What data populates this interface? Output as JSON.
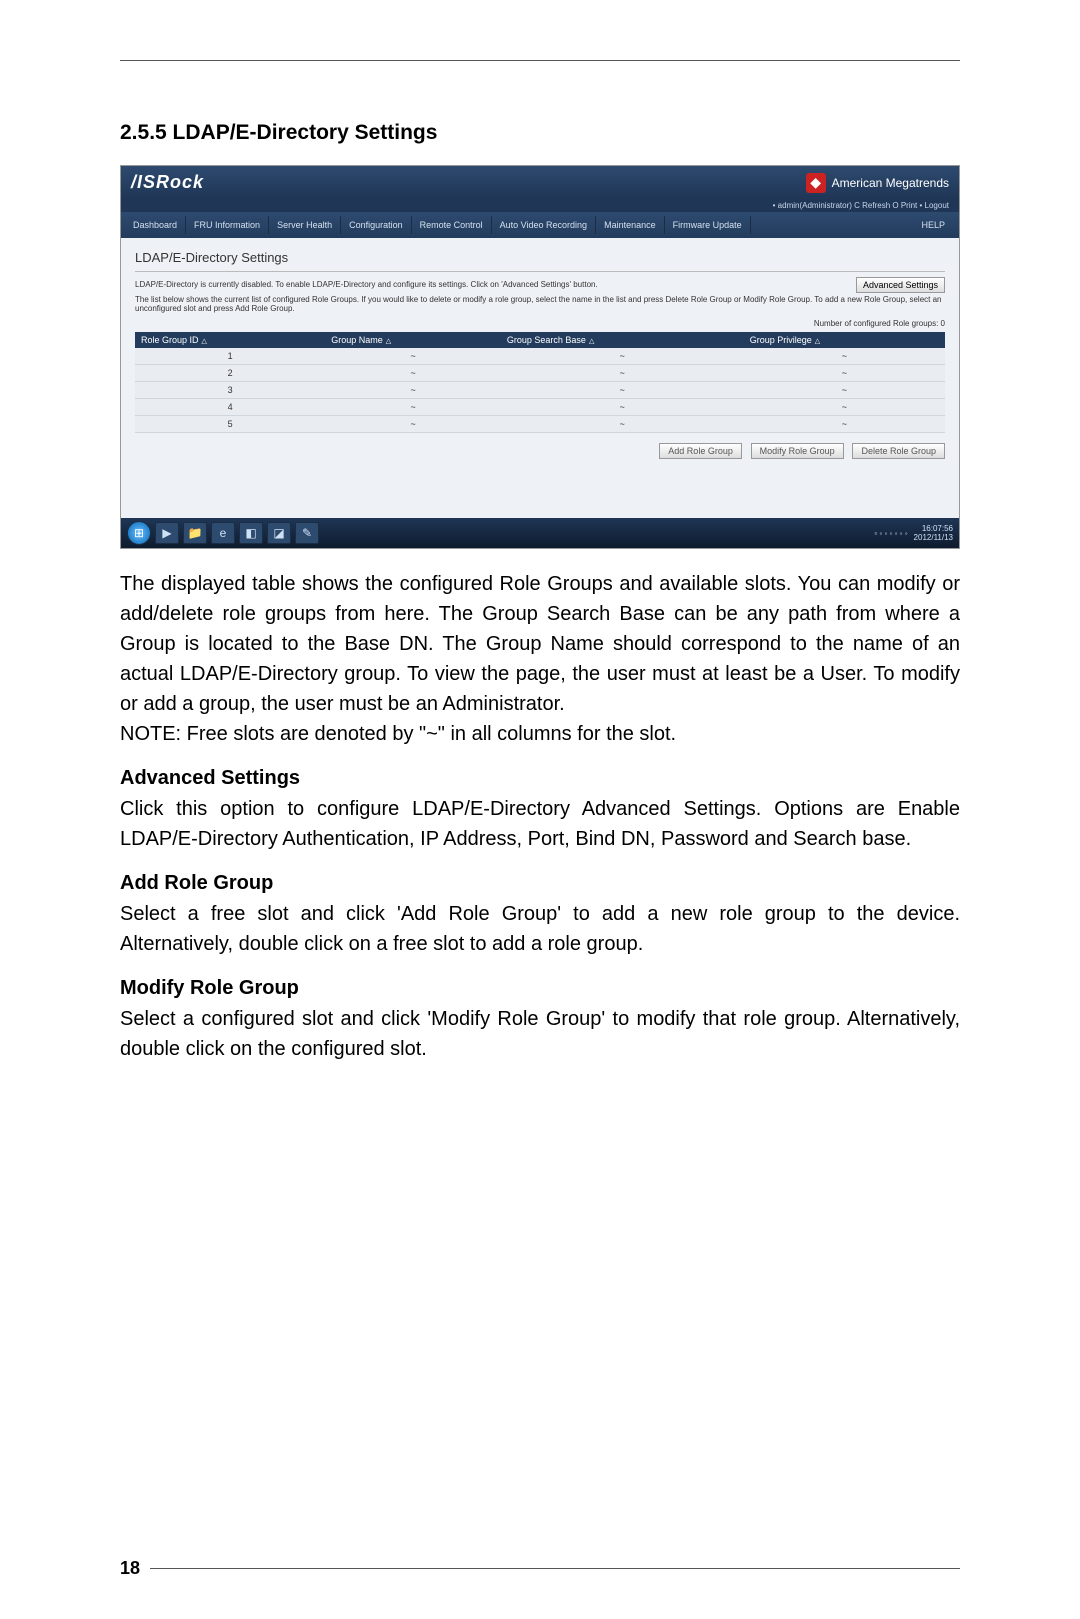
{
  "section_title": "2.5.5  LDAP/E-Directory Settings",
  "screenshot": {
    "logo": "/ISRock",
    "brand": "American Megatrends",
    "topbar": "• admin(Administrator)   C Refresh   O Print   • Logout",
    "nav": [
      "Dashboard",
      "FRU Information",
      "Server Health",
      "Configuration",
      "Remote Control",
      "Auto Video Recording",
      "Maintenance",
      "Firmware Update"
    ],
    "help": "HELP",
    "page_title": "LDAP/E-Directory Settings",
    "desc1": "LDAP/E-Directory is currently disabled. To enable LDAP/E-Directory and configure its settings. Click on 'Advanced Settings' button.",
    "adv_btn": "Advanced Settings",
    "desc2": "The list below shows the current list of configured Role Groups. If you would like to delete or modify a role group, select the name in the list and press Delete Role Group or Modify Role Group. To add a new Role Group, select an unconfigured slot and press Add Role Group.",
    "count_label": "Number of configured Role groups: 0",
    "columns": [
      "Role Group ID",
      "Group Name",
      "Group Search Base",
      "Group Privilege"
    ],
    "rows": [
      {
        "id": "1",
        "name": "~",
        "base": "~",
        "priv": "~"
      },
      {
        "id": "2",
        "name": "~",
        "base": "~",
        "priv": "~"
      },
      {
        "id": "3",
        "name": "~",
        "base": "~",
        "priv": "~"
      },
      {
        "id": "4",
        "name": "~",
        "base": "~",
        "priv": "~"
      },
      {
        "id": "5",
        "name": "~",
        "base": "~",
        "priv": "~"
      }
    ],
    "btn_add": "Add Role Group",
    "btn_mod": "Modify Role Group",
    "btn_del": "Delete Role Group",
    "time": "16:07:56\n2012/11/13"
  },
  "para1": "The displayed table shows the configured Role Groups and available slots. You can modify or add/delete role groups from here. The Group Search Base can be any path from where a Group is located to the Base DN. The Group Name should correspond to the name of an actual LDAP/E-Directory group. To view the page, the user must at least be a User. To modify or add a group, the user must be an Administrator.",
  "para1_note": "NOTE: Free slots are denoted by \"~\" in all columns for the slot.",
  "h_adv": "Advanced Settings",
  "p_adv": "Click this option to configure LDAP/E-Directory Advanced Settings. Options are Enable LDAP/E-Directory Authentication, IP Address, Port, Bind DN, Password and Search base.",
  "h_add": "Add Role Group",
  "p_add": "Select a free slot and click 'Add Role Group' to add a new role group to the device. Alternatively, double click on a free slot to add a role group.",
  "h_mod": "Modify Role Group",
  "p_mod": "Select a configured slot and click 'Modify Role Group' to modify that role group. Alternatively, double click on the configured slot.",
  "page_number": "18"
}
